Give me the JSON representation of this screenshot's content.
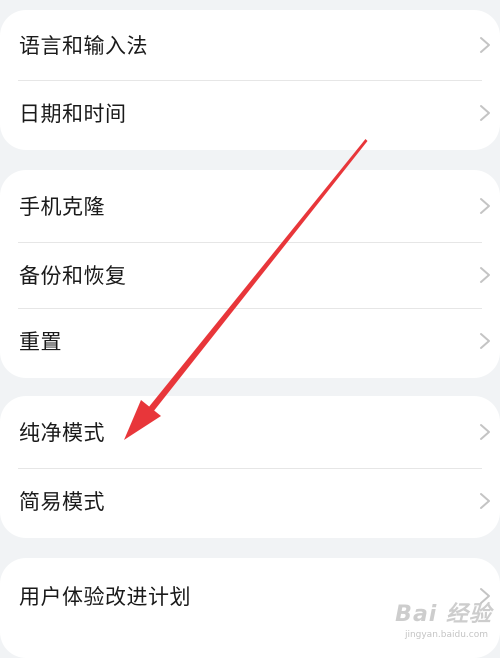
{
  "groups": [
    {
      "items": [
        {
          "label": "语言和输入法"
        },
        {
          "label": "日期和时间"
        }
      ]
    },
    {
      "items": [
        {
          "label": "手机克隆"
        },
        {
          "label": "备份和恢复"
        },
        {
          "label": "重置"
        }
      ]
    },
    {
      "items": [
        {
          "label": "纯净模式"
        },
        {
          "label": "简易模式"
        }
      ]
    },
    {
      "items": [
        {
          "label": "用户体验改进计划"
        }
      ]
    }
  ],
  "annotation": {
    "type": "arrow",
    "color": "#e8363a",
    "points_to": "纯净模式"
  },
  "watermark": {
    "text": "Bai 经验",
    "subtext": "jingyan.baidu.com"
  },
  "colors": {
    "background": "#f1f3f5",
    "card": "#ffffff",
    "text": "#1a1a1a",
    "chevron": "#c4c4c4",
    "divider": "#e6e6e6"
  }
}
